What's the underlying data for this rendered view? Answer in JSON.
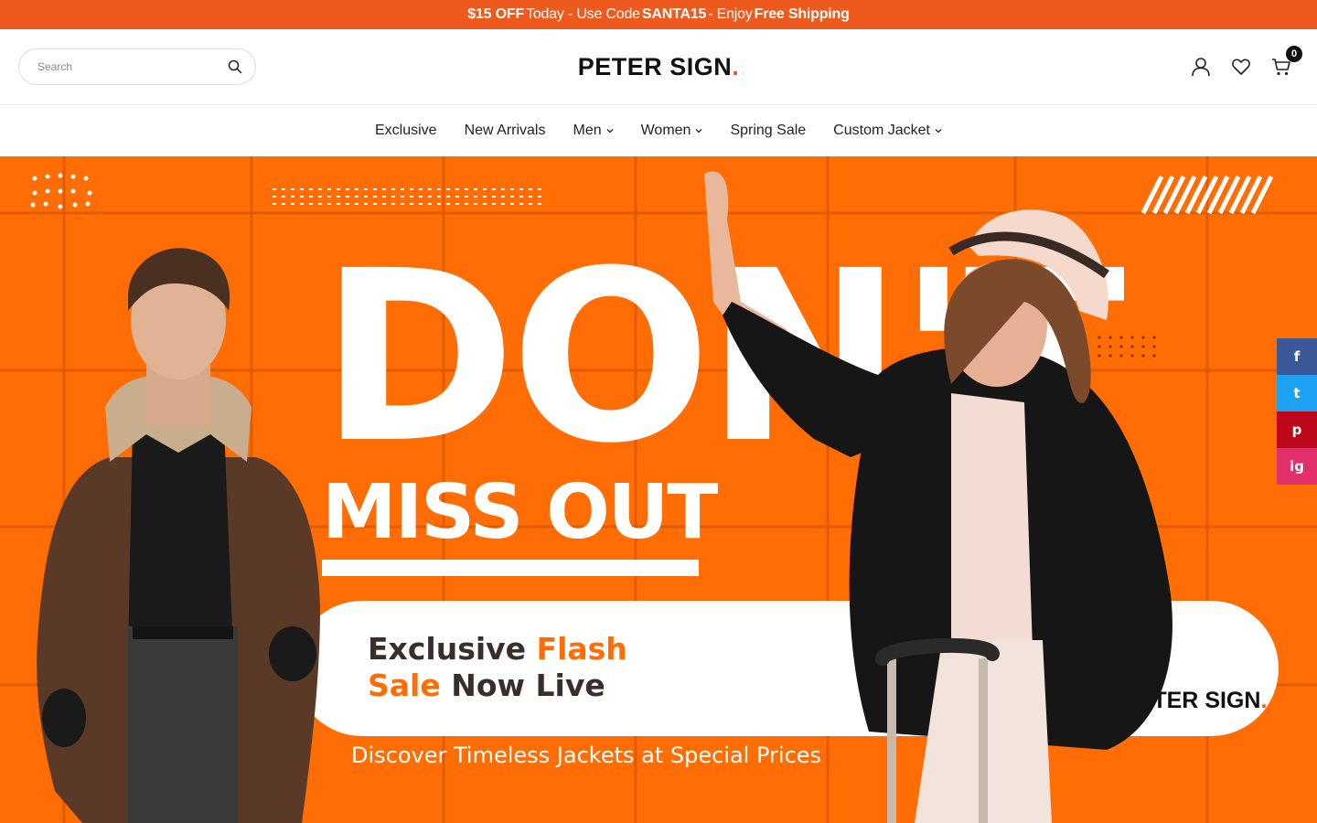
{
  "announcement": {
    "amount": "$15 OFF",
    "text1": "Today - Use Code",
    "code": "SANTA15",
    "text2": "- Enjoy",
    "shipping": "Free Shipping"
  },
  "header": {
    "search_placeholder": "Search",
    "logo_part1": "PETER",
    "logo_part2": "SIGN",
    "logo_dot": ".",
    "cart_count": "0"
  },
  "nav": {
    "items": [
      {
        "label": "Exclusive",
        "dropdown": false
      },
      {
        "label": "New Arrivals",
        "dropdown": false
      },
      {
        "label": "Men",
        "dropdown": true
      },
      {
        "label": "Women",
        "dropdown": true
      },
      {
        "label": "Spring Sale",
        "dropdown": false
      },
      {
        "label": "Custom Jacket",
        "dropdown": true
      }
    ]
  },
  "hero": {
    "headline": "DON'T",
    "subheadline": "MISS OUT",
    "pill_line1_a": "Exclusive",
    "pill_line1_b": "Flash",
    "pill_line2_a": "Sale",
    "pill_line2_b": "Now Live",
    "pill_logo_part1": "PETER",
    "pill_logo_part2": "SIGN",
    "pill_logo_dot": ".",
    "tagline": "Discover Timeless Jackets at Special Prices"
  },
  "social": {
    "facebook": "f",
    "twitter": "t",
    "pinterest": "p",
    "instagram": "ig"
  },
  "colors": {
    "brand_orange": "#ee5a1d",
    "hero_bg": "#ff6d04",
    "facebook": "#3b5998",
    "twitter": "#1da1f2",
    "pinterest": "#bd081c",
    "instagram": "#e1306c"
  }
}
